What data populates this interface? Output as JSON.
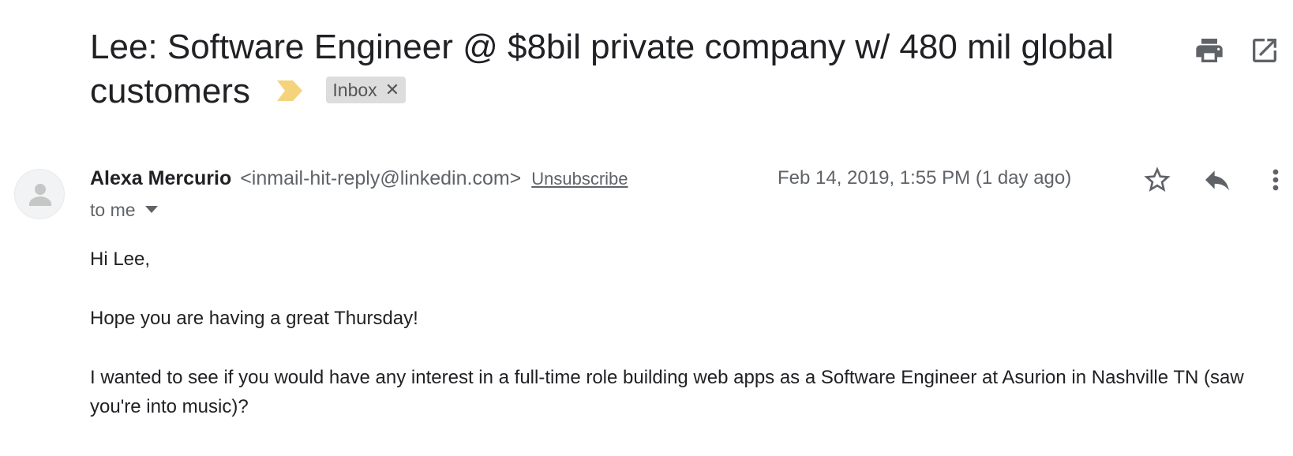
{
  "email": {
    "subject": "Lee: Software Engineer @ $8bil private company w/ 480 mil global customers",
    "label": "Inbox",
    "label_remove": "✕",
    "sender_name": "Alexa Mercurio",
    "sender_email": "<inmail-hit-reply@linkedin.com>",
    "unsubscribe": "Unsubscribe",
    "recipient": "to me",
    "date": "Feb 14, 2019, 1:55 PM (1 day ago)",
    "body": [
      "Hi Lee,",
      "Hope you are having a great Thursday!",
      "I wanted to see if you would have any interest in a full-time role building web apps as a Software Engineer at Asurion in Nashville TN (saw you're into music)?"
    ]
  },
  "icons": {
    "print": "print-icon",
    "open_new_window": "open-in-new-window-icon",
    "star": "star-icon",
    "reply": "reply-icon",
    "more": "more-vertical-icon",
    "importance": "importance-marker-icon",
    "avatar": "default-avatar-icon"
  },
  "colors": {
    "importance_marker": "#f4d37a",
    "label_chip_bg": "#dddddd",
    "secondary_text": "#5f6368"
  }
}
